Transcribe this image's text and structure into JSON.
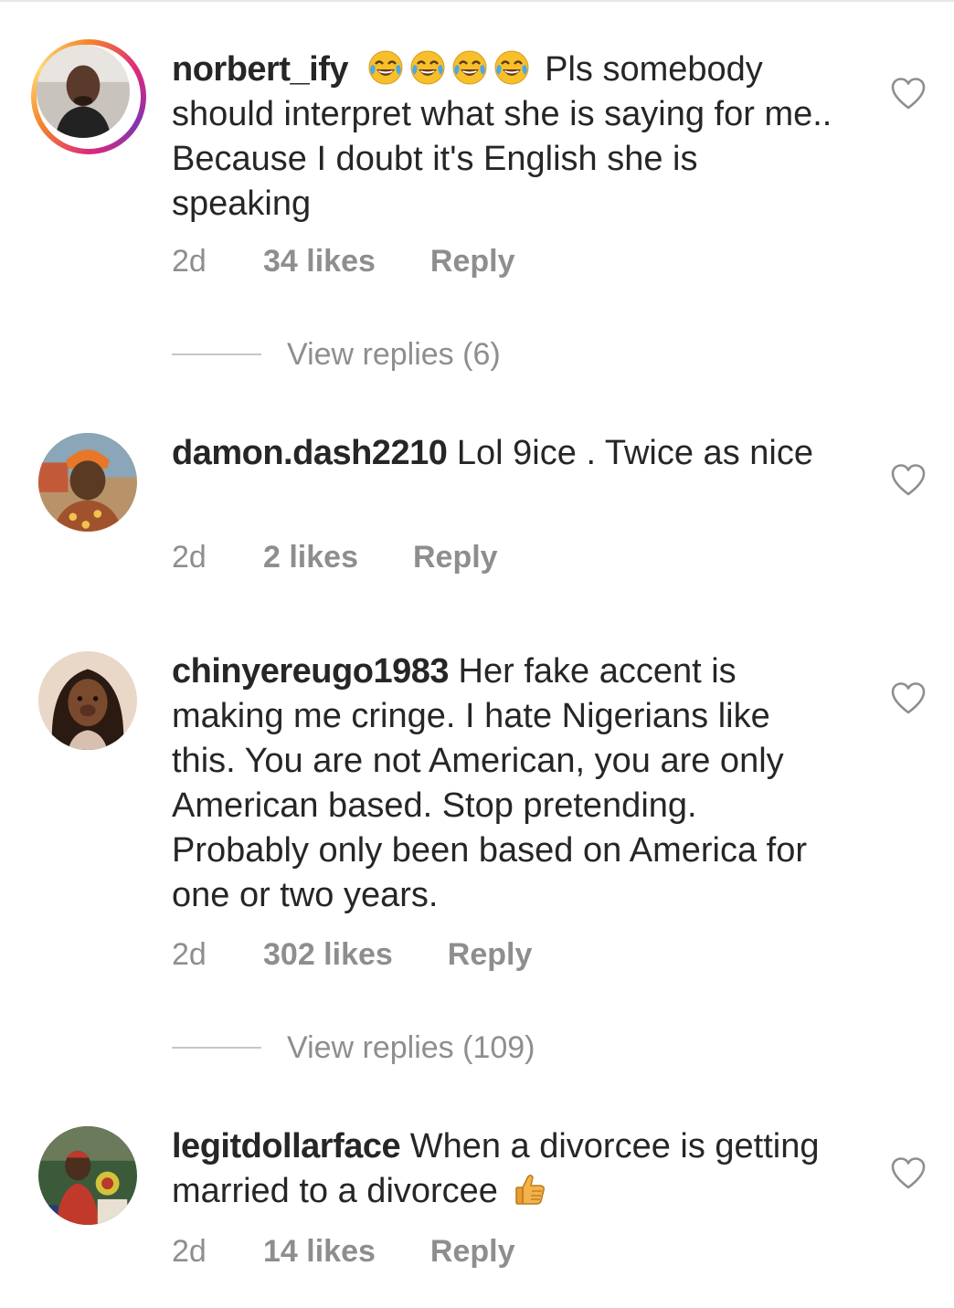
{
  "comments": [
    {
      "username": "norbert_ify",
      "emojis": [
        "face-with-tears-of-joy",
        "face-with-tears-of-joy",
        "face-with-tears-of-joy",
        "face-with-tears-of-joy"
      ],
      "text": "Pls somebody should interpret what she is saying for me.. Because I doubt it's English she is speaking",
      "time": "2d",
      "likes": "34 likes",
      "reply": "Reply",
      "view_replies": "View replies (6)",
      "has_story": true
    },
    {
      "username": "damon.dash2210",
      "text": "Lol 9ice . Twice as nice",
      "time": "2d",
      "likes": "2 likes",
      "reply": "Reply"
    },
    {
      "username": "chinyereugo1983",
      "text": "Her fake accent is making me cringe. I hate Nigerians like this. You are not American, you are only American based. Stop pretending. Probably only been based on America for one or two years.",
      "time": "2d",
      "likes": "302 likes",
      "reply": "Reply",
      "view_replies": "View replies (109)"
    },
    {
      "username": "legitdollarface",
      "text": "When a divorcee is getting married to a divorcee",
      "trailing_emoji": "thumbs-up",
      "time": "2d",
      "likes": "14 likes",
      "reply": "Reply"
    }
  ],
  "icons": {
    "like": "heart-outline-icon",
    "laugh": "face-with-tears-of-joy",
    "thumbs": "thumbs-up"
  },
  "colors": {
    "text": "#262626",
    "secondary": "#8e8e8e",
    "divider": "#c7c7c7"
  }
}
